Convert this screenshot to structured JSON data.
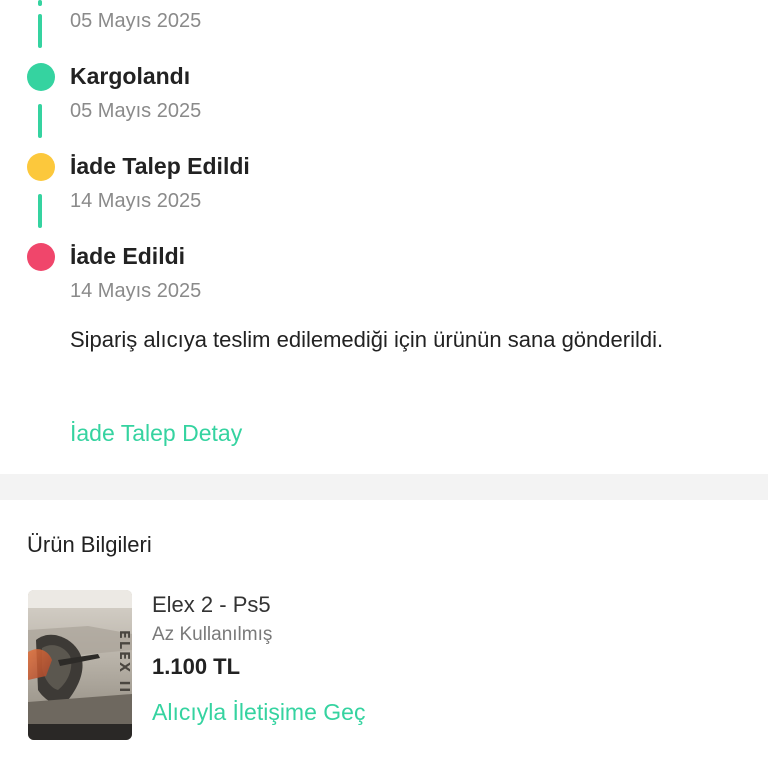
{
  "timeline": {
    "first_date": "05 Mayıs 2025",
    "steps": [
      {
        "title": "Kargolandı",
        "date": "05 Mayıs 2025",
        "status_color": "#35d3a0"
      },
      {
        "title": "İade Talep Edildi",
        "date": "14 Mayıs 2025",
        "status_color": "#fcc83c"
      },
      {
        "title": "İade Edildi",
        "date": "14 Mayıs 2025",
        "status_color": "#f0466b"
      }
    ],
    "description": "Sipariş alıcıya teslim edilemediği için ürünün sana gönderildi.",
    "return_detail_link": "İade Talep Detay"
  },
  "product": {
    "section_title": "Ürün Bilgileri",
    "name": "Elex 2 - Ps5",
    "condition": "Az Kullanılmış",
    "price": "1.100 TL",
    "contact_link": "Alıcıyla İletişime Geç",
    "cover_text": "ELEX II"
  },
  "colors": {
    "accent": "#35d3a0",
    "pending": "#fcc83c",
    "returned": "#f0466b",
    "muted": "#8a8a8a"
  }
}
